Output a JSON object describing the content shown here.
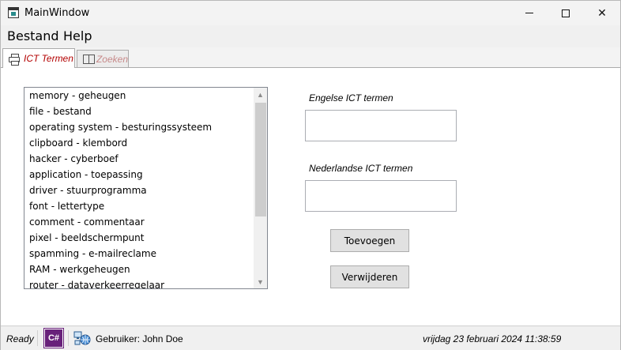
{
  "window": {
    "title": "MainWindow"
  },
  "menu": {
    "items": [
      "Bestand",
      "Help"
    ]
  },
  "tabs": [
    {
      "label": "ICT Termen",
      "icon": "printer-icon",
      "active": true
    },
    {
      "label": "Zoeken",
      "icon": "book-icon",
      "active": false
    }
  ],
  "list": {
    "items": [
      "memory - geheugen",
      "file - bestand",
      "operating system - besturingssysteem",
      "clipboard - klembord",
      "hacker - cyberboef",
      "application - toepassing",
      "driver - stuurprogramma",
      "font - lettertype",
      "comment - commentaar",
      "pixel - beeldschermpunt",
      "spamming - e-mailreclame",
      "RAM - werkgeheugen",
      "router - dataverkeerregelaar"
    ]
  },
  "form": {
    "english_label": "Engelse ICT termen",
    "english_value": "",
    "dutch_label": "Nederlandse ICT termen",
    "dutch_value": "",
    "add_button": "Toevoegen",
    "delete_button": "Verwijderen"
  },
  "status": {
    "state": "Ready",
    "csharp_badge": "C#",
    "user": "Gebruiker: John Doe",
    "datetime": "vrijdag 23 februari 2024 11:38:59"
  },
  "colors": {
    "active_tab_text": "#b30000",
    "inactive_tab_text": "#c78a8a",
    "csharp_badge": "#68217a"
  }
}
